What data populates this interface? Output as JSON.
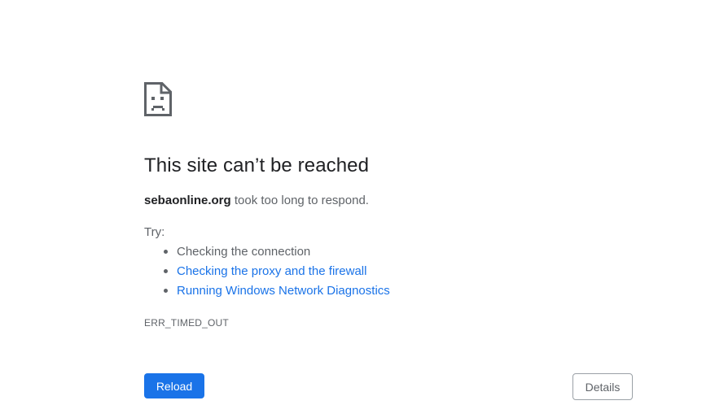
{
  "error": {
    "icon": "sad-document-icon",
    "heading": "This site can’t be reached",
    "host": "sebaonline.org",
    "summary_rest": " took too long to respond.",
    "try_label": "Try:",
    "suggestions": [
      {
        "text": "Checking the connection",
        "is_link": false
      },
      {
        "text": "Checking the proxy and the firewall",
        "is_link": true
      },
      {
        "text": "Running Windows Network Diagnostics",
        "is_link": true
      }
    ],
    "code": "ERR_TIMED_OUT"
  },
  "buttons": {
    "reload_label": "Reload",
    "details_label": "Details"
  },
  "colors": {
    "primary": "#1a73e8",
    "heading_text": "#202124",
    "body_text": "#5f6368"
  }
}
